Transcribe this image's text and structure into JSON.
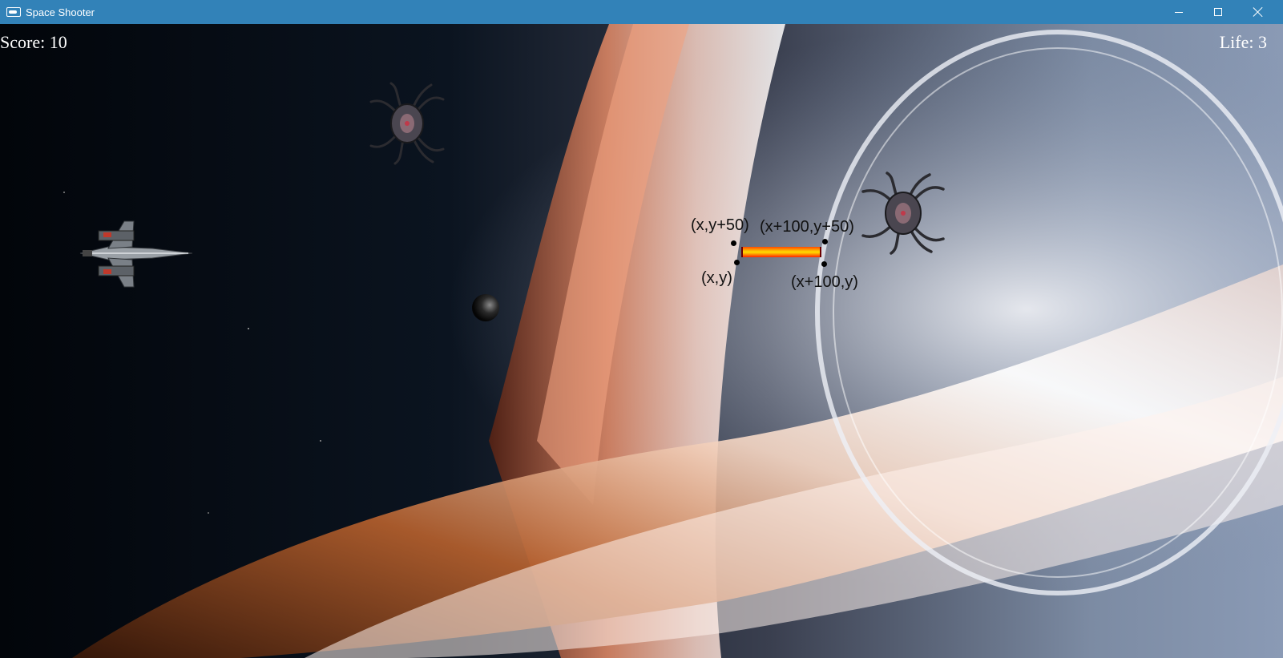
{
  "window": {
    "title": "Space Shooter",
    "icon": "app-icon",
    "controls": [
      "minimize-icon",
      "maximize-icon",
      "close-icon"
    ]
  },
  "hud": {
    "score_label": "Score: ",
    "score": 10,
    "life_label": "Life: ",
    "life": 3
  },
  "laser_annotation": {
    "top_left": "(x,y+50)",
    "top_right": "(x+100,y+50)",
    "bottom_left": "(x,y)",
    "bottom_right": "(x+100,y)"
  },
  "sprites": {
    "player": "player-ship",
    "enemies": [
      "enemy-ship",
      "enemy-ship"
    ],
    "laser": "laser-beam",
    "planet": "moon"
  },
  "colors": {
    "titlebar": "#3282b8",
    "hud_text": "#ffffff",
    "laser_core": "#ffd200",
    "laser_edge": "#ff4a00"
  }
}
